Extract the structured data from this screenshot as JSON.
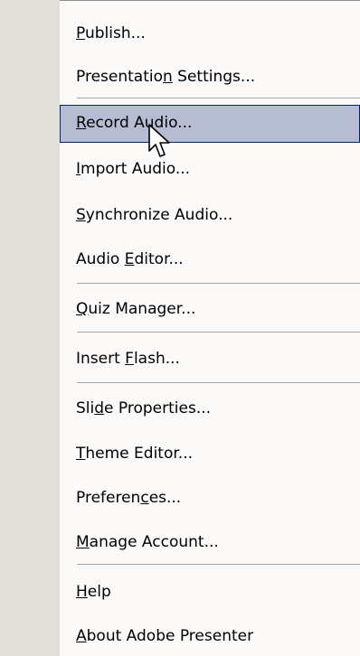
{
  "menu": {
    "items": [
      {
        "pre": "",
        "key": "P",
        "post": "ublish..."
      },
      {
        "pre": "Presentatio",
        "key": "n",
        "post": " Settings..."
      },
      {
        "pre": "",
        "key": "R",
        "post": "ecord Audio..."
      },
      {
        "pre": "",
        "key": "I",
        "post": "mport Audio..."
      },
      {
        "pre": "",
        "key": "S",
        "post": "ynchronize Audio..."
      },
      {
        "pre": "Audio ",
        "key": "E",
        "post": "ditor..."
      },
      {
        "pre": "",
        "key": "Q",
        "post": "uiz Manager..."
      },
      {
        "pre": "Insert ",
        "key": "F",
        "post": "lash..."
      },
      {
        "pre": "Sli",
        "key": "d",
        "post": "e Properties..."
      },
      {
        "pre": "",
        "key": "T",
        "post": "heme Editor..."
      },
      {
        "pre": "Preferen",
        "key": "c",
        "post": "es..."
      },
      {
        "pre": "",
        "key": "M",
        "post": "anage Account..."
      },
      {
        "pre": "",
        "key": "H",
        "post": "elp"
      },
      {
        "pre": "",
        "key": "A",
        "post": "bout Adobe Presenter"
      }
    ],
    "highlighted_index": 2,
    "highlight_color": "#b6bdd2",
    "highlight_border_color": "#0a246a",
    "gutter_color": "#e1e0d8"
  }
}
